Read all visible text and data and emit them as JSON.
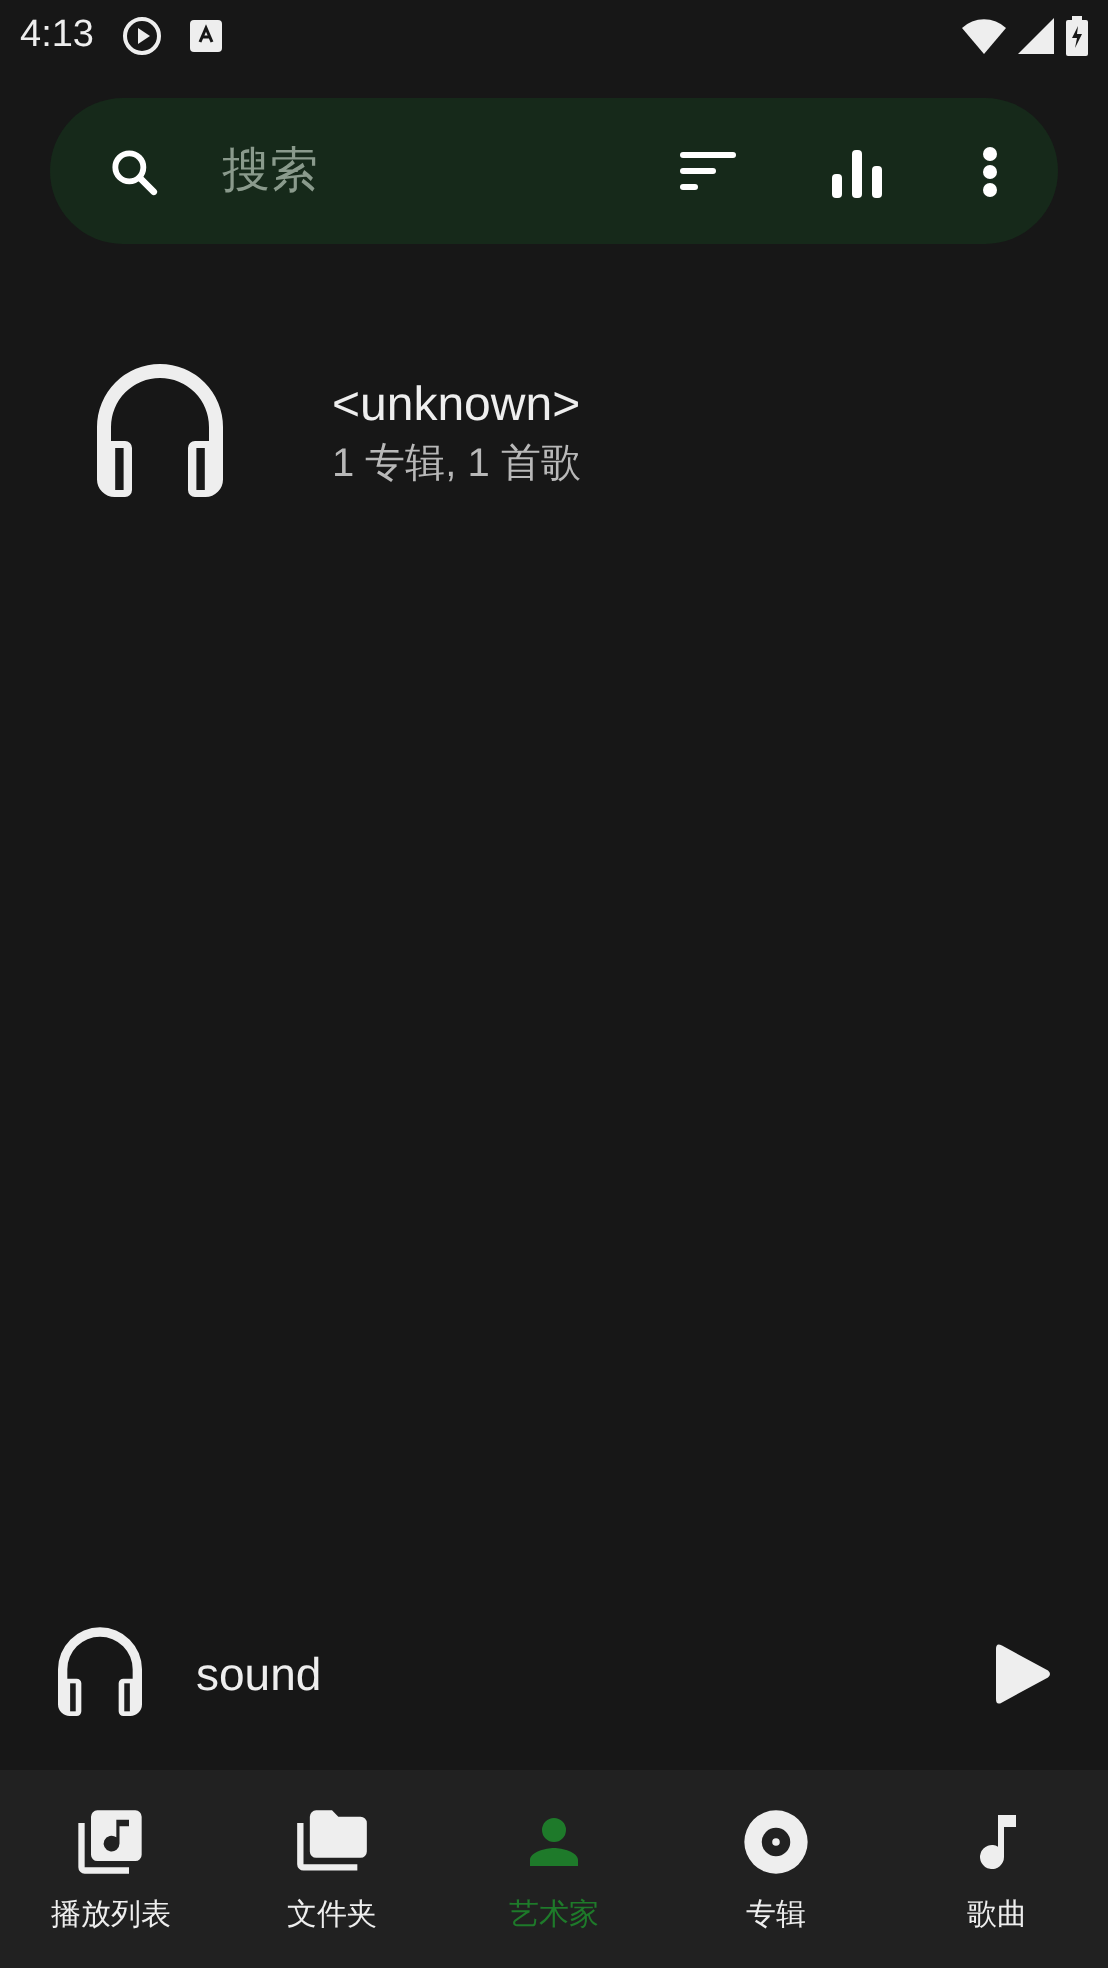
{
  "status_bar": {
    "time": "4:13"
  },
  "search": {
    "placeholder": "搜索"
  },
  "artists": [
    {
      "name": "<unknown>",
      "summary": "1 专辑, 1 首歌"
    }
  ],
  "now_playing": {
    "title": "sound"
  },
  "nav": [
    {
      "label": "播放列表",
      "kind": "playlist",
      "selected": false
    },
    {
      "label": "文件夹",
      "kind": "folder",
      "selected": false
    },
    {
      "label": "艺术家",
      "kind": "artist",
      "selected": true
    },
    {
      "label": "专辑",
      "kind": "album",
      "selected": false
    },
    {
      "label": "歌曲",
      "kind": "song",
      "selected": false
    }
  ]
}
